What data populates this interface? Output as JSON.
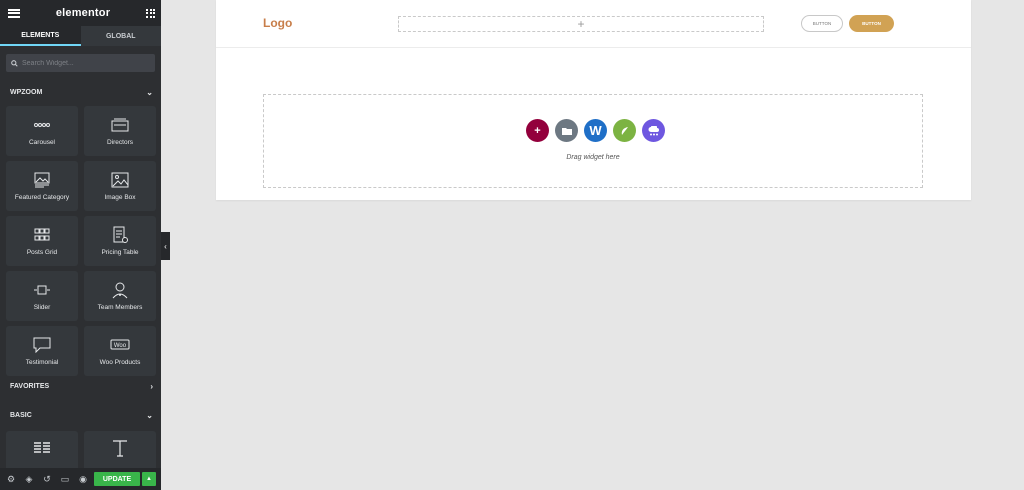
{
  "panel": {
    "brand": "elementor",
    "tabs": [
      "ELEMENTS",
      "GLOBAL"
    ],
    "search_placeholder": "Search Widget...",
    "sections": {
      "wpzoom": "WPZOOM",
      "favorites": "FAVORITES",
      "basic": "BASIC"
    },
    "widgets": [
      {
        "label": "Carousel",
        "icon": "carousel-icon"
      },
      {
        "label": "Directors",
        "icon": "directors-icon"
      },
      {
        "label": "Featured Category",
        "icon": "featured-category-icon"
      },
      {
        "label": "Image Box",
        "icon": "image-box-icon"
      },
      {
        "label": "Posts Grid",
        "icon": "posts-grid-icon"
      },
      {
        "label": "Pricing Table",
        "icon": "pricing-table-icon"
      },
      {
        "label": "Slider",
        "icon": "slider-icon"
      },
      {
        "label": "Team Members",
        "icon": "team-members-icon"
      },
      {
        "label": "Testimonial",
        "icon": "testimonial-icon"
      },
      {
        "label": "Woo Products",
        "icon": "woo-products-icon"
      }
    ],
    "basic_widgets": [
      {
        "icon": "columns-icon"
      },
      {
        "icon": "heading-icon"
      }
    ],
    "footer": {
      "update_label": "UPDATE"
    },
    "accent_color": "#71d7f7",
    "update_color": "#39b54a"
  },
  "canvas": {
    "logo": "Logo",
    "header_add": "+",
    "button_outline": "BUTTON",
    "button_fill": "BUTTON",
    "drag_text": "Drag widget here",
    "add_icons": [
      {
        "icon": "add-section-icon",
        "color": "#93003c",
        "glyph": "+"
      },
      {
        "icon": "template-library-icon",
        "color": "#6d7882",
        "glyph": ""
      },
      {
        "icon": "wpzoom-icon",
        "color": "#1f6fc7",
        "glyph": "W"
      },
      {
        "icon": "envato-elements-icon",
        "color": "#7cb342",
        "glyph": ""
      },
      {
        "icon": "cloud-templates-icon",
        "color": "#6e57e0",
        "glyph": ""
      }
    ],
    "logo_color": "#c87e4a",
    "button_fill_color": "#d1a254"
  }
}
